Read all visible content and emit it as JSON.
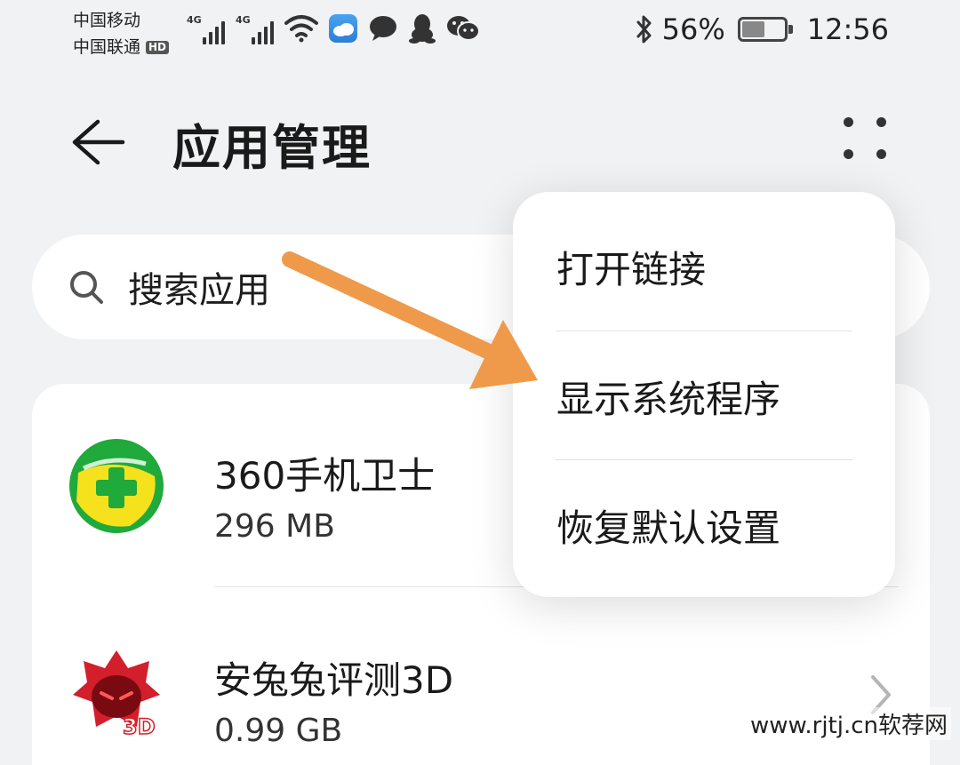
{
  "status_bar": {
    "carrier_1": "中国移动",
    "carrier_2": "中国联通",
    "hd_badge": "HD",
    "network_1": "4G",
    "network_2": "4G",
    "battery_percent": "56%",
    "battery_level": 0.56,
    "time": "12:56",
    "icons": [
      "signal-icon",
      "wifi-icon",
      "weather-icon",
      "message-icon",
      "qq-icon",
      "wechat-icon",
      "bluetooth-icon",
      "battery-icon"
    ]
  },
  "header": {
    "title": "应用管理",
    "back_icon": "back-arrow-icon",
    "more_icon": "more-icon"
  },
  "search": {
    "placeholder": "搜索应用",
    "icon": "search-icon"
  },
  "apps": [
    {
      "name": "360手机卫士",
      "size": "296 MB",
      "icon": "360-security-icon"
    },
    {
      "name": "安兔兔评测3D",
      "size": "0.99 GB",
      "icon": "antutu-3d-icon",
      "icon_badge": "3D"
    }
  ],
  "menu": {
    "items": [
      "打开链接",
      "显示系统程序",
      "恢复默认设置"
    ]
  },
  "watermark": "www.rjtj.cn软荐网",
  "colors": {
    "background": "#f1f2f4",
    "card": "#ffffff",
    "arrow_annotation": "#ef9a4b",
    "icon_360_green": "#1faa3b",
    "icon_360_yellow": "#f5e11c",
    "icon_antutu_red": "#d21f2b"
  }
}
